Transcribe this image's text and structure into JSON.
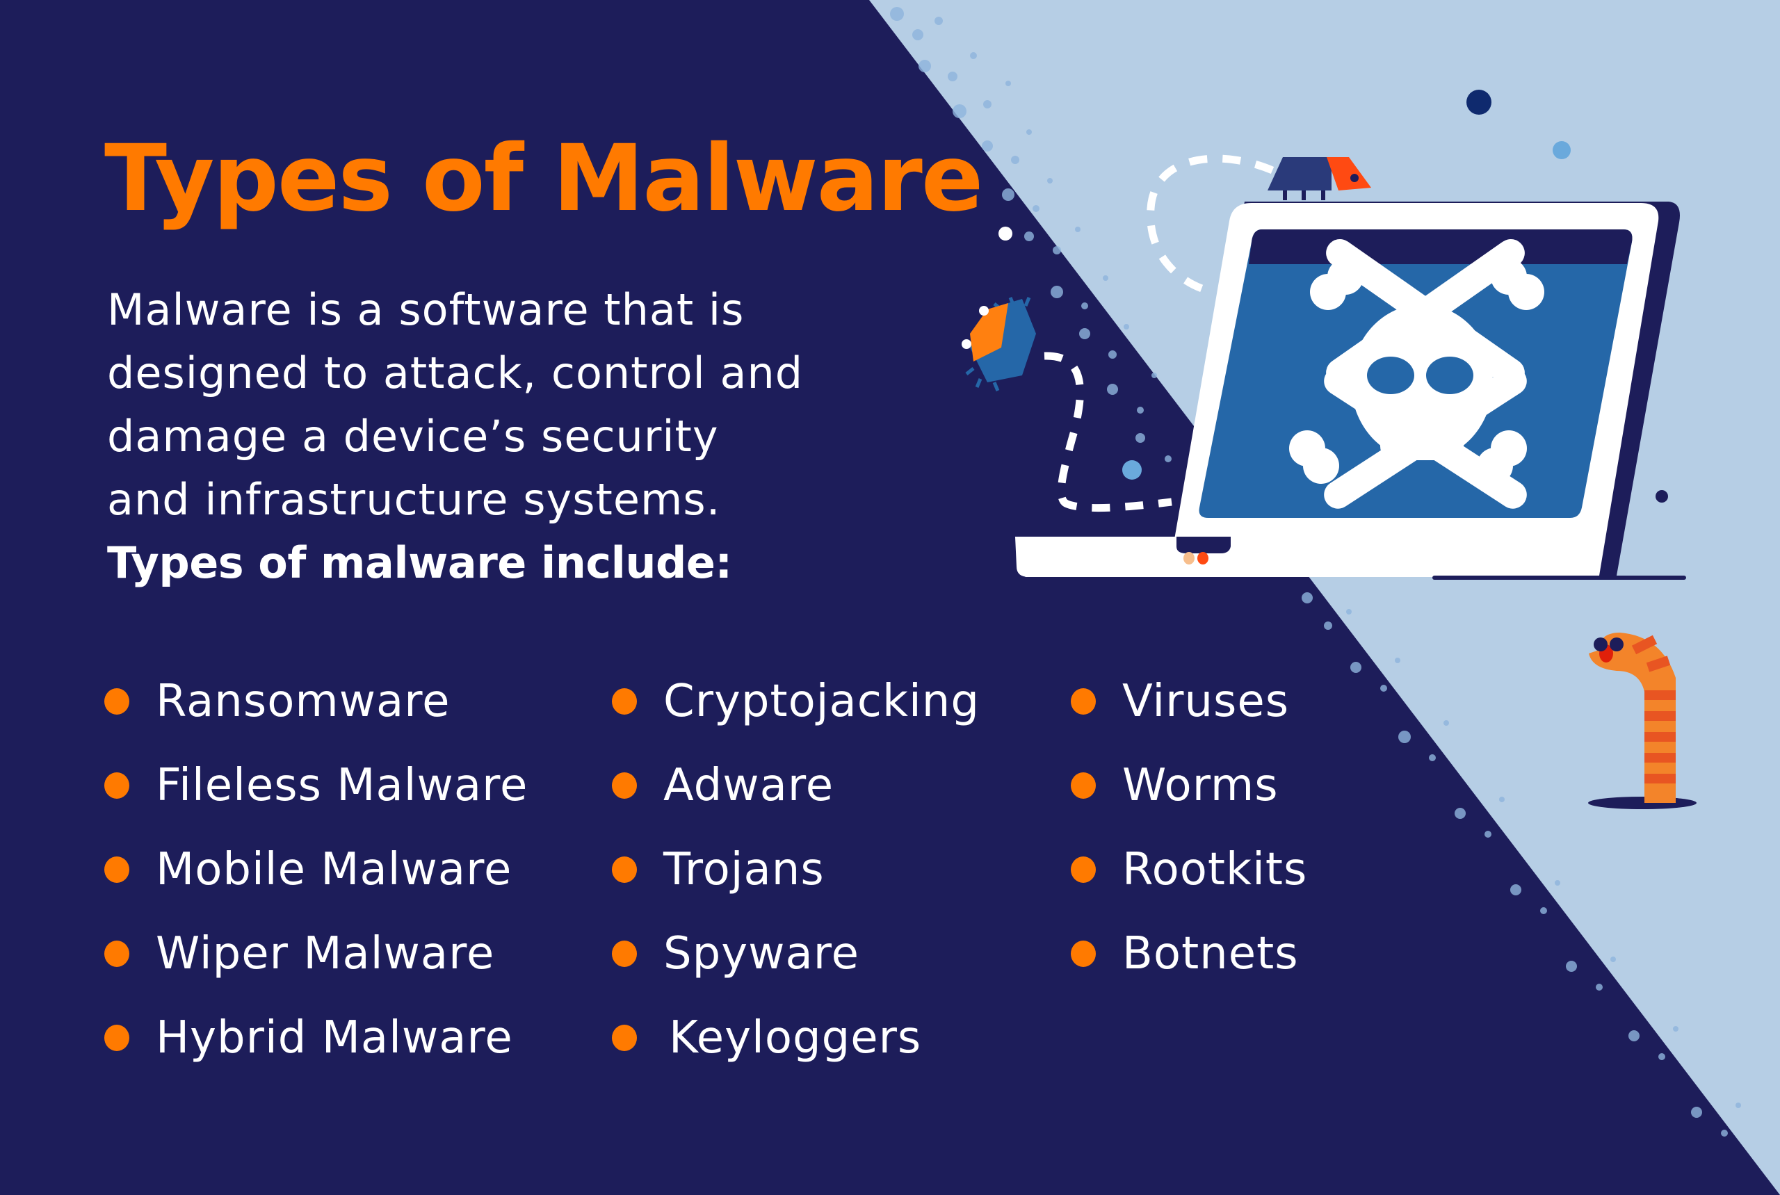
{
  "title": "Types of Malware",
  "intro": {
    "lines": [
      "Malware is a software that is",
      "designed to attack, control and",
      "damage a device’s security",
      "and infrastructure systems."
    ],
    "lead_in": "Types of malware include:"
  },
  "malware_types": {
    "column_1": [
      "Ransomware",
      "Fileless Malware",
      "Mobile Malware",
      "Wiper Malware",
      "Hybrid Malware"
    ],
    "column_2": [
      "Cryptojacking",
      "Adware",
      "Trojans",
      "Spyware",
      "Keyloggers"
    ],
    "column_3": [
      "Viruses",
      "Worms",
      "Rootkits",
      "Botnets"
    ]
  },
  "illustration": {
    "subjects": [
      "laptop-with-skull-and-crossbones",
      "bug-on-laptop",
      "chip-bug",
      "worm"
    ]
  },
  "colors": {
    "background_dark": "#1D1D5A",
    "background_light": "#B6CEE5",
    "accent_orange": "#FF7A00",
    "screen_blue": "#2567A8",
    "text_white": "#FFFFFF",
    "alert_red": "#FF4A12"
  }
}
